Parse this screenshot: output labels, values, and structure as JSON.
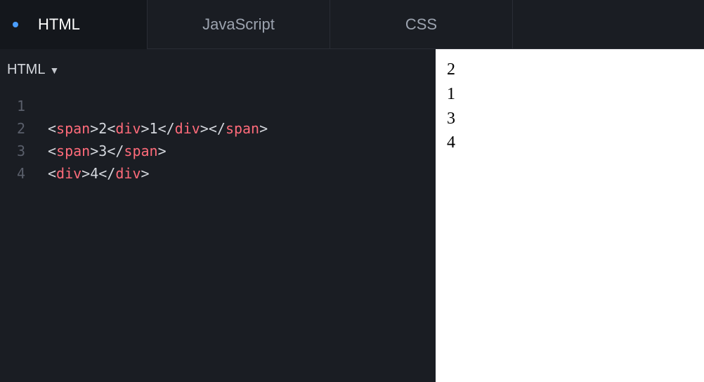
{
  "tabs": {
    "html": "HTML",
    "js": "JavaScript",
    "css": "CSS"
  },
  "lang_selector": {
    "label": "HTML"
  },
  "code": {
    "lines": [
      {
        "num": "1",
        "tokens": []
      },
      {
        "num": "2",
        "tokens": [
          {
            "t": "punct",
            "v": "<"
          },
          {
            "t": "tagname",
            "v": "span"
          },
          {
            "t": "punct",
            "v": ">"
          },
          {
            "t": "plain",
            "v": "2"
          },
          {
            "t": "punct",
            "v": "<"
          },
          {
            "t": "tagname",
            "v": "div"
          },
          {
            "t": "punct",
            "v": ">"
          },
          {
            "t": "plain",
            "v": "1"
          },
          {
            "t": "punct",
            "v": "</"
          },
          {
            "t": "tagname",
            "v": "div"
          },
          {
            "t": "punct",
            "v": ">"
          },
          {
            "t": "punct",
            "v": "</"
          },
          {
            "t": "tagname",
            "v": "span"
          },
          {
            "t": "punct",
            "v": ">"
          }
        ]
      },
      {
        "num": "3",
        "tokens": [
          {
            "t": "punct",
            "v": "<"
          },
          {
            "t": "tagname",
            "v": "span"
          },
          {
            "t": "punct",
            "v": ">"
          },
          {
            "t": "plain",
            "v": "3"
          },
          {
            "t": "punct",
            "v": "</"
          },
          {
            "t": "tagname",
            "v": "span"
          },
          {
            "t": "punct",
            "v": ">"
          }
        ]
      },
      {
        "num": "4",
        "tokens": [
          {
            "t": "punct",
            "v": "<"
          },
          {
            "t": "tagname",
            "v": "div"
          },
          {
            "t": "punct",
            "v": ">"
          },
          {
            "t": "plain",
            "v": "4"
          },
          {
            "t": "punct",
            "v": "</"
          },
          {
            "t": "tagname",
            "v": "div"
          },
          {
            "t": "punct",
            "v": ">"
          }
        ]
      }
    ]
  },
  "preview": {
    "line1": "2",
    "line2": "1",
    "line3": "3",
    "line4": "4"
  }
}
